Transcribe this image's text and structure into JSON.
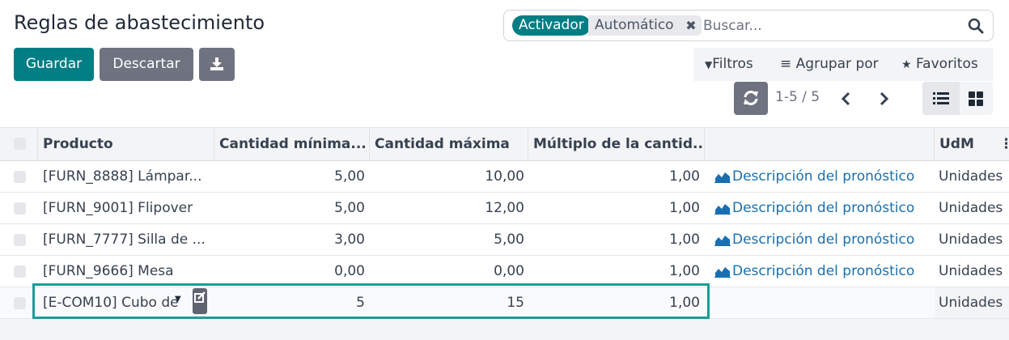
{
  "page_title": "Reglas de abastecimiento",
  "search": {
    "facet_key": "Activador",
    "facet_value": "Automático",
    "placeholder": "Buscar..."
  },
  "toolbar": {
    "save_label": "Guardar",
    "discard_label": "Descartar"
  },
  "filters": {
    "filters_label": "Filtros",
    "group_label": "Agrupar por",
    "favorites_label": "Favoritos"
  },
  "pager": {
    "value": "1-5 / 5"
  },
  "table": {
    "headers": {
      "product": "Producto",
      "min_qty": "Cantidad mínima...",
      "max_qty": "Cantidad máxima",
      "multiple": "Múltiplo de la cantid...",
      "forecast": "",
      "uom": "UdM"
    },
    "rows": [
      {
        "product": "[FURN_8888] Lámpar...",
        "min": "5,00",
        "max": "10,00",
        "multiple": "1,00",
        "forecast": "Descripción del pronóstico",
        "uom": "Unidades"
      },
      {
        "product": "[FURN_9001] Flipover",
        "min": "5,00",
        "max": "12,00",
        "multiple": "1,00",
        "forecast": "Descripción del pronóstico",
        "uom": "Unidades"
      },
      {
        "product": "[FURN_7777] Silla de ...",
        "min": "3,00",
        "max": "5,00",
        "multiple": "1,00",
        "forecast": "Descripción del pronóstico",
        "uom": "Unidades"
      },
      {
        "product": "[FURN_9666] Mesa",
        "min": "0,00",
        "max": "0,00",
        "multiple": "1,00",
        "forecast": "Descripción del pronóstico",
        "uom": "Unidades"
      },
      {
        "product": "[E-COM10] Cubo de",
        "min": "5",
        "max": "15",
        "multiple": "1,00",
        "forecast": "",
        "uom": "Unidades"
      }
    ]
  },
  "colors": {
    "primary": "#017e84",
    "secondary": "#6f7380",
    "link": "#1a6fb0",
    "edit_border": "#1a9e96"
  }
}
